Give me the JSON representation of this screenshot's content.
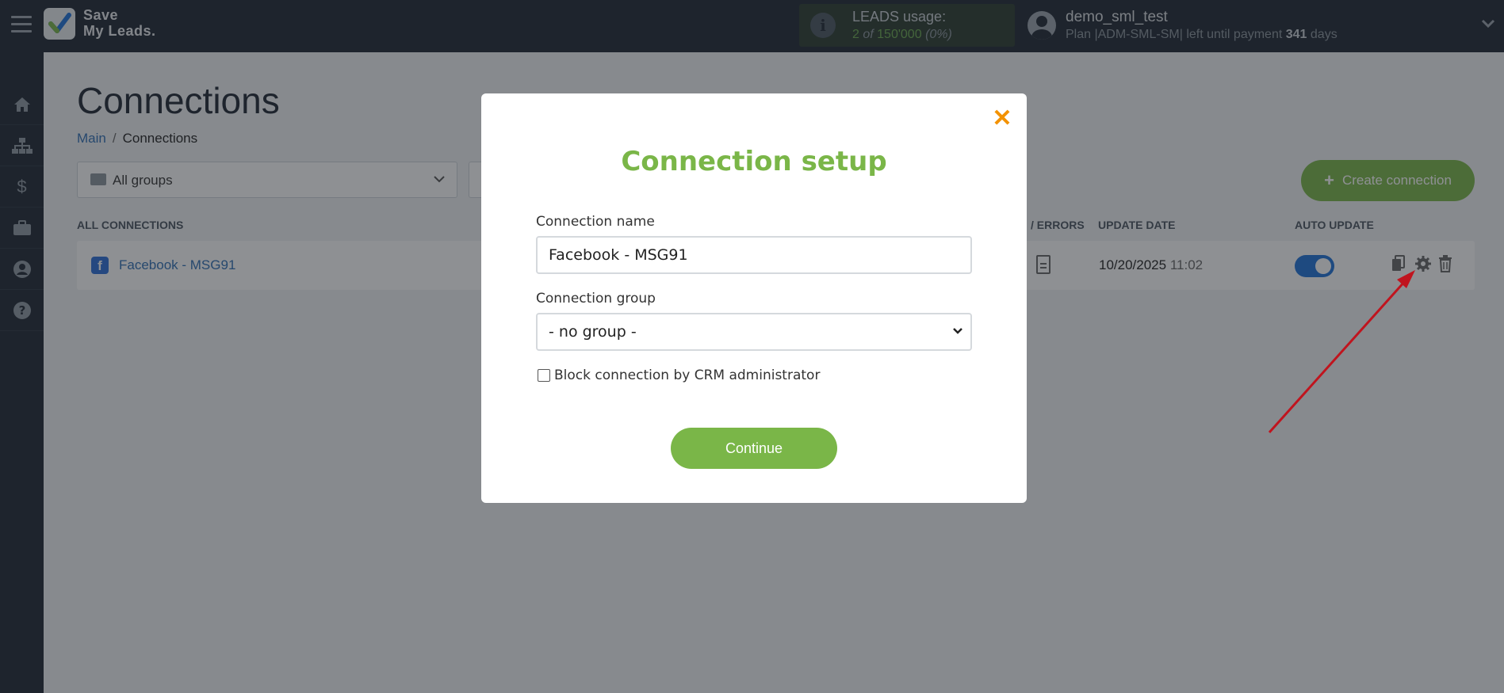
{
  "app": {
    "logo_line1": "Save",
    "logo_line2": "My Leads.",
    "leads_title": "LEADS usage:",
    "leads_used": "2",
    "leads_of": "of",
    "leads_total": "150'000",
    "leads_pct": "(0%)",
    "user_name": "demo_sml_test",
    "plan_prefix": "Plan |ADM-SML-SM| left until payment",
    "plan_days": "341",
    "plan_suffix": "days"
  },
  "sidebar": {
    "items": [
      {
        "icon": "home-icon"
      },
      {
        "icon": "sitemap-icon"
      },
      {
        "icon": "dollar-icon"
      },
      {
        "icon": "briefcase-icon"
      },
      {
        "icon": "user-icon"
      },
      {
        "icon": "help-icon"
      }
    ]
  },
  "page": {
    "title": "Connections",
    "breadcrumb_main": "Main",
    "breadcrumb_sep": "/",
    "breadcrumb_current": "Connections",
    "group_filter": "All groups",
    "create_button": "Create connection",
    "col_all": "ALL CONNECTIONS",
    "col_errors": "/ ERRORS",
    "col_update_date": "UPDATE DATE",
    "col_auto_update": "AUTO UPDATE"
  },
  "connection": {
    "name": "Facebook - MSG91",
    "date": "10/20/2025",
    "time": "11:02",
    "auto_update": true
  },
  "modal": {
    "title": "Connection setup",
    "name_label": "Connection name",
    "name_value": "Facebook - MSG91",
    "group_label": "Connection group",
    "group_value": "- no group -",
    "block_label": "Block connection by CRM administrator",
    "continue": "Continue"
  },
  "colors": {
    "accent_green": "#7ab648",
    "close_orange": "#f39200",
    "toggle_blue": "#1f73d8",
    "arrow_red": "#c0141e"
  }
}
